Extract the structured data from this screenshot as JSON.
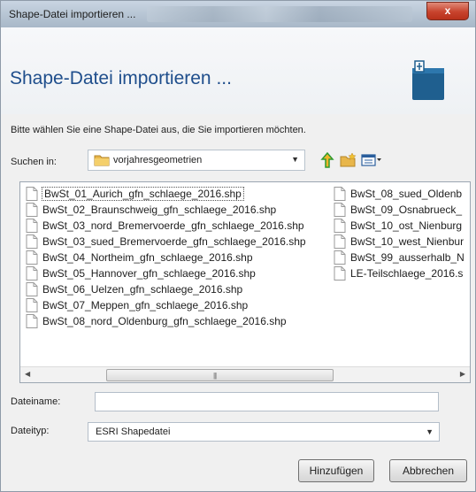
{
  "window": {
    "title": "Shape-Datei importieren ...",
    "close_label": "x"
  },
  "header": {
    "title": "Shape-Datei importieren ..."
  },
  "instruction": "Bitte wählen Sie eine Shape-Datei aus, die Sie importieren möchten.",
  "look_in": {
    "label": "Suchen in:",
    "value": "vorjahresgeometrien"
  },
  "files_col1": [
    "BwSt_01_Aurich_gfn_schlaege_2016.shp",
    "BwSt_02_Braunschweig_gfn_schlaege_2016.shp",
    "BwSt_03_nord_Bremervoerde_gfn_schlaege_2016.shp",
    "BwSt_03_sued_Bremervoerde_gfn_schlaege_2016.shp",
    "BwSt_04_Northeim_gfn_schlaege_2016.shp",
    "BwSt_05_Hannover_gfn_schlaege_2016.shp",
    "BwSt_06_Uelzen_gfn_schlaege_2016.shp",
    "BwSt_07_Meppen_gfn_schlaege_2016.shp",
    "BwSt_08_nord_Oldenburg_gfn_schlaege_2016.shp"
  ],
  "files_col2": [
    "BwSt_08_sued_Oldenb",
    "BwSt_09_Osnabrueck_",
    "BwSt_10_ost_Nienburg",
    "BwSt_10_west_Nienbur",
    "BwSt_99_ausserhalb_N",
    "LE-Teilschlaege_2016.s"
  ],
  "filename": {
    "label": "Dateiname:",
    "value": ""
  },
  "filetype": {
    "label": "Dateityp:",
    "value": "ESRI Shapedatei"
  },
  "buttons": {
    "add": "Hinzufügen",
    "cancel": "Abbrechen"
  },
  "icons": {
    "folder": "folder-icon",
    "up": "up-folder-icon",
    "new_folder": "new-folder-icon",
    "view": "view-menu-icon",
    "file": "file-icon",
    "header": "import-shape-icon"
  },
  "colors": {
    "header_title": "#1f4e8c",
    "header_icon": "#1f5f8f",
    "close": "#c8432d"
  }
}
